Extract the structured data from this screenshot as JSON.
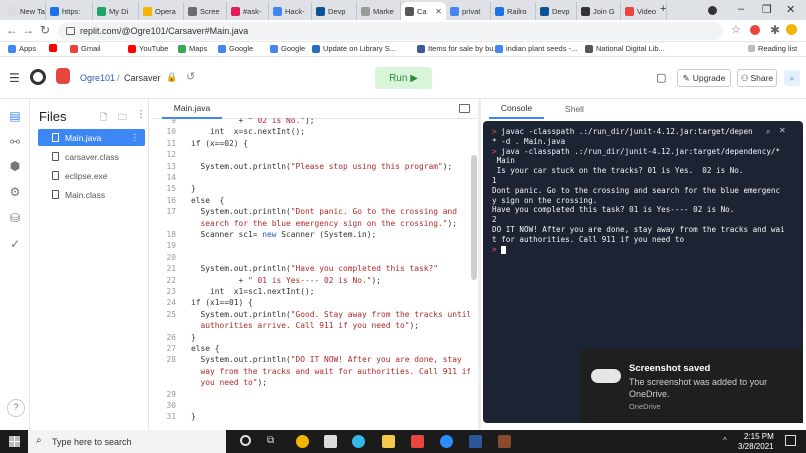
{
  "browser": {
    "tabs": [
      {
        "label": "New Tab",
        "color": "#dadce0"
      },
      {
        "label": "https:",
        "color": "#1a73e8"
      },
      {
        "label": "My Di",
        "color": "#1fa463"
      },
      {
        "label": "Opera",
        "color": "#f4b400"
      },
      {
        "label": "Scree",
        "color": "#6c6c6c"
      },
      {
        "label": "#ask-",
        "color": "#e01e5a"
      },
      {
        "label": "Hack-",
        "color": "#3d87f5"
      },
      {
        "label": "Devp",
        "color": "#0b5394"
      },
      {
        "label": "Marke",
        "color": "#999999"
      },
      {
        "label": "Ca",
        "color": "#555555",
        "active": true
      },
      {
        "label": "privat",
        "color": "#4285f4"
      },
      {
        "label": "Railro",
        "color": "#1a73e8"
      },
      {
        "label": "Devp",
        "color": "#0b5394"
      },
      {
        "label": "Join G",
        "color": "#333333"
      },
      {
        "label": "Video",
        "color": "#e8453c"
      }
    ],
    "new_tab_symbol": "+",
    "url": "replit.com/@Ogre101/Carsaver#Main.java",
    "bookmarks": [
      {
        "label": "Apps",
        "color": "#4285f4"
      },
      {
        "label": "",
        "color": "#ff0000"
      },
      {
        "label": "Gmail",
        "color": "#ea4335"
      },
      {
        "label": "YouTube",
        "color": "#ff0000"
      },
      {
        "label": "Maps",
        "color": "#34a853"
      },
      {
        "label": "Google",
        "color": "#4285f4"
      },
      {
        "label": "Google",
        "color": "#4285f4"
      },
      {
        "label": "Update on Library S...",
        "color": "#2a6ebb"
      },
      {
        "label": "Items for sale by bu...",
        "color": "#3b5998"
      },
      {
        "label": "indian plant seeds -...",
        "color": "#4285f4"
      },
      {
        "label": "National Digital Lib...",
        "color": "#555555"
      }
    ],
    "reading_list": "Reading list"
  },
  "replit": {
    "user": "Ogre101",
    "separator": "/",
    "repl": "Carsaver",
    "run_label": "Run ▶",
    "upgrade_label": "Upgrade",
    "share_label": "Share",
    "accent": "#3d87f5",
    "run_bg": "#d7f5d8",
    "run_color": "#2b8a3e"
  },
  "files": {
    "title": "Files",
    "items": [
      {
        "name": "Main.java",
        "active": true
      },
      {
        "name": "carsaver.class"
      },
      {
        "name": "eclipse.exe"
      },
      {
        "name": "Main.class"
      }
    ]
  },
  "editor": {
    "tab": "Main.java",
    "lines": [
      {
        "n": "9",
        "html": "          + \" <span class='str'>02 is No.\"</span>);"
      },
      {
        "n": "10",
        "html": "    int  x=sc.nextInt();"
      },
      {
        "n": "11",
        "html": "if (x==02) {"
      },
      {
        "n": "12",
        "html": ""
      },
      {
        "n": "13",
        "html": "  System.out.println(<span class='str'>\"Please stop using this program\"</span>);"
      },
      {
        "n": "14",
        "html": ""
      },
      {
        "n": "15",
        "html": "}"
      },
      {
        "n": "16",
        "html": "else  {"
      },
      {
        "n": "17",
        "html": "  System.out.println(<span class='str'>\"Dont panic. Go to the crossing and</span>"
      },
      {
        "n": "",
        "html": "  <span class='str'>search for the blue emergency sign on the crossing.\"</span>);"
      },
      {
        "n": "18",
        "html": "  Scanner sc1= <span class='kw'>new</span> Scanner (System.in);"
      },
      {
        "n": "19",
        "html": ""
      },
      {
        "n": "20",
        "html": ""
      },
      {
        "n": "21",
        "html": "  System.out.println(<span class='str'>\"Have you completed this task?\"</span>"
      },
      {
        "n": "22",
        "html": "          + <span class='str'>\" 01 is Yes---- 02 is No.\"</span>);"
      },
      {
        "n": "23",
        "html": "    int  x1=sc1.nextInt();"
      },
      {
        "n": "24",
        "html": "if (x1==01) {"
      },
      {
        "n": "25",
        "html": "  System.out.println(<span class='str'>\"Good. Stay away from the tracks until</span>"
      },
      {
        "n": "",
        "html": "  <span class='str'>authorities arrive. Call 911 if you need to\"</span>);"
      },
      {
        "n": "26",
        "html": "}"
      },
      {
        "n": "27",
        "html": "else {"
      },
      {
        "n": "28",
        "html": "  System.out.println(<span class='str'>\"DO IT NOW! After you are done, stay</span>"
      },
      {
        "n": "",
        "html": "  <span class='str'>way from the tracks and wait for authorities. Call 911 if</span>"
      },
      {
        "n": "",
        "html": "  <span class='str'>you need to\"</span>);"
      },
      {
        "n": "29",
        "html": ""
      },
      {
        "n": "30",
        "html": ""
      },
      {
        "n": "31",
        "html": "}"
      }
    ]
  },
  "console": {
    "tab_console": "Console",
    "tab_shell": "Shell",
    "lines": [
      {
        "p": "> ",
        "t": "javac -classpath .:/run_dir/junit-4.12.jar:target/depen"
      },
      {
        "p": "",
        "t": "* -d . Main.java"
      },
      {
        "p": "> ",
        "t": "java -classpath .:/run_dir/junit-4.12.jar:target/dependency/*"
      },
      {
        "p": "",
        "t": " Main"
      },
      {
        "p": "",
        "t": " Is your car stuck on the tracks? 01 is Yes.  02 is No."
      },
      {
        "p": "",
        "t": "1"
      },
      {
        "p": "",
        "t": "Dont panic. Go to the crossing and search for the blue emergenc"
      },
      {
        "p": "",
        "t": "y sign on the crossing."
      },
      {
        "p": "",
        "t": "Have you completed this task? 01 is Yes---- 02 is No."
      },
      {
        "p": "",
        "t": "2"
      },
      {
        "p": "",
        "t": "DO IT NOW! After you are done, stay away from the tracks and wai"
      },
      {
        "p": "",
        "t": "t for authorities. Call 911 if you need to"
      },
      {
        "p": "> ",
        "t": ""
      }
    ],
    "bg": "#1c2333"
  },
  "toast": {
    "title": "Screenshot saved",
    "body": "The screenshot was added to your OneDrive.",
    "source": "OneDrive"
  },
  "taskbar": {
    "search_placeholder": "Type here to search",
    "time": "2:15 PM",
    "date": "3/28/2021"
  }
}
